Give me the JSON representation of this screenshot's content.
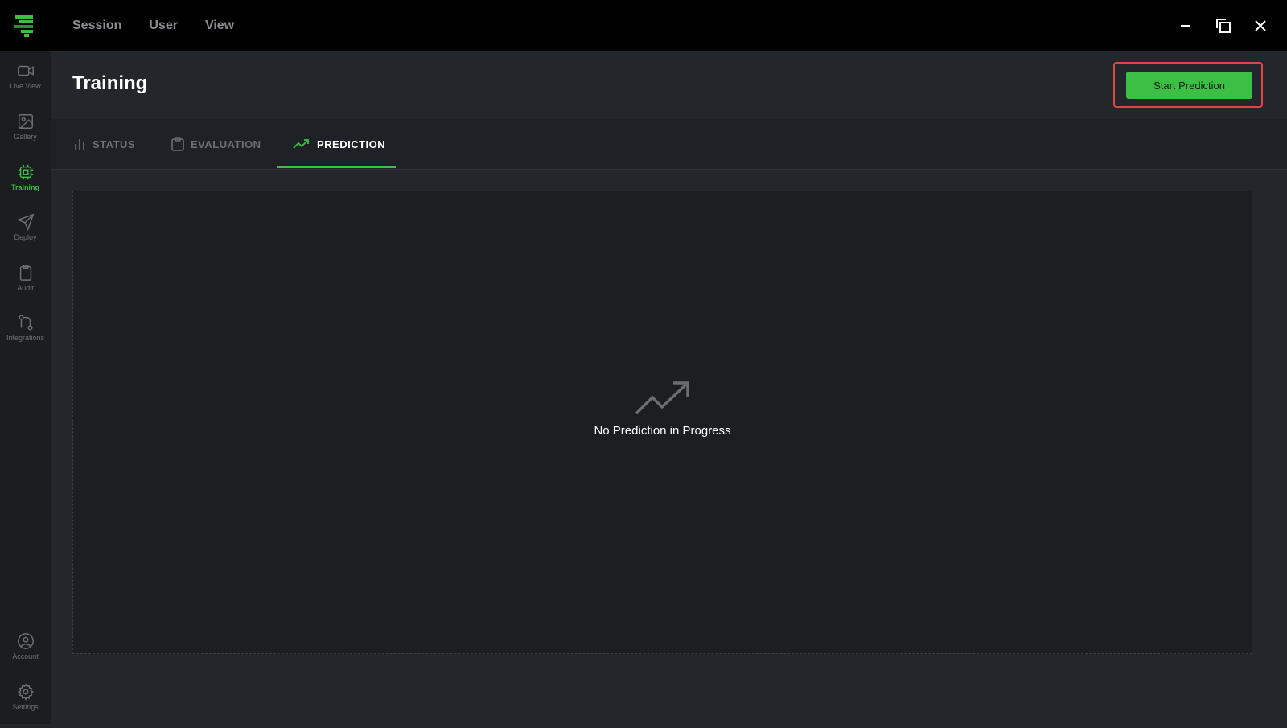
{
  "titlebar": {
    "menu": [
      "Session",
      "User",
      "View"
    ],
    "window_controls": [
      "minimize-icon",
      "restore-icon",
      "close-icon"
    ]
  },
  "sidebar": {
    "items": [
      {
        "label": "Live View",
        "icon": "video-camera-icon",
        "active": false
      },
      {
        "label": "Gallery",
        "icon": "image-icon",
        "active": false
      },
      {
        "label": "Training",
        "icon": "cpu-chip-icon",
        "active": true
      },
      {
        "label": "Deploy",
        "icon": "paper-plane-icon",
        "active": false
      },
      {
        "label": "Audit",
        "icon": "clipboard-icon",
        "active": false
      },
      {
        "label": "Integrations",
        "icon": "git-branch-icon",
        "active": false
      }
    ],
    "bottom_items": [
      {
        "label": "Account",
        "icon": "user-circle-icon"
      },
      {
        "label": "Settings",
        "icon": "gear-icon"
      }
    ]
  },
  "header": {
    "title": "Training",
    "start_button_label": "Start Prediction"
  },
  "tabs": [
    {
      "label": "STATUS",
      "icon": "bar-chart-icon",
      "active": false
    },
    {
      "label": "EVALUATION",
      "icon": "clipboard-icon",
      "active": false
    },
    {
      "label": "PREDICTION",
      "icon": "trending-up-icon",
      "active": true
    }
  ],
  "content": {
    "empty_message": "No Prediction in Progress",
    "empty_icon": "trending-up-icon"
  },
  "colors": {
    "accent": "#3bbf45",
    "highlight_border": "#e0463f",
    "titlebar_bg": "#000000",
    "sidebar_bg": "#1b1d21",
    "page_bg": "#23262b"
  }
}
